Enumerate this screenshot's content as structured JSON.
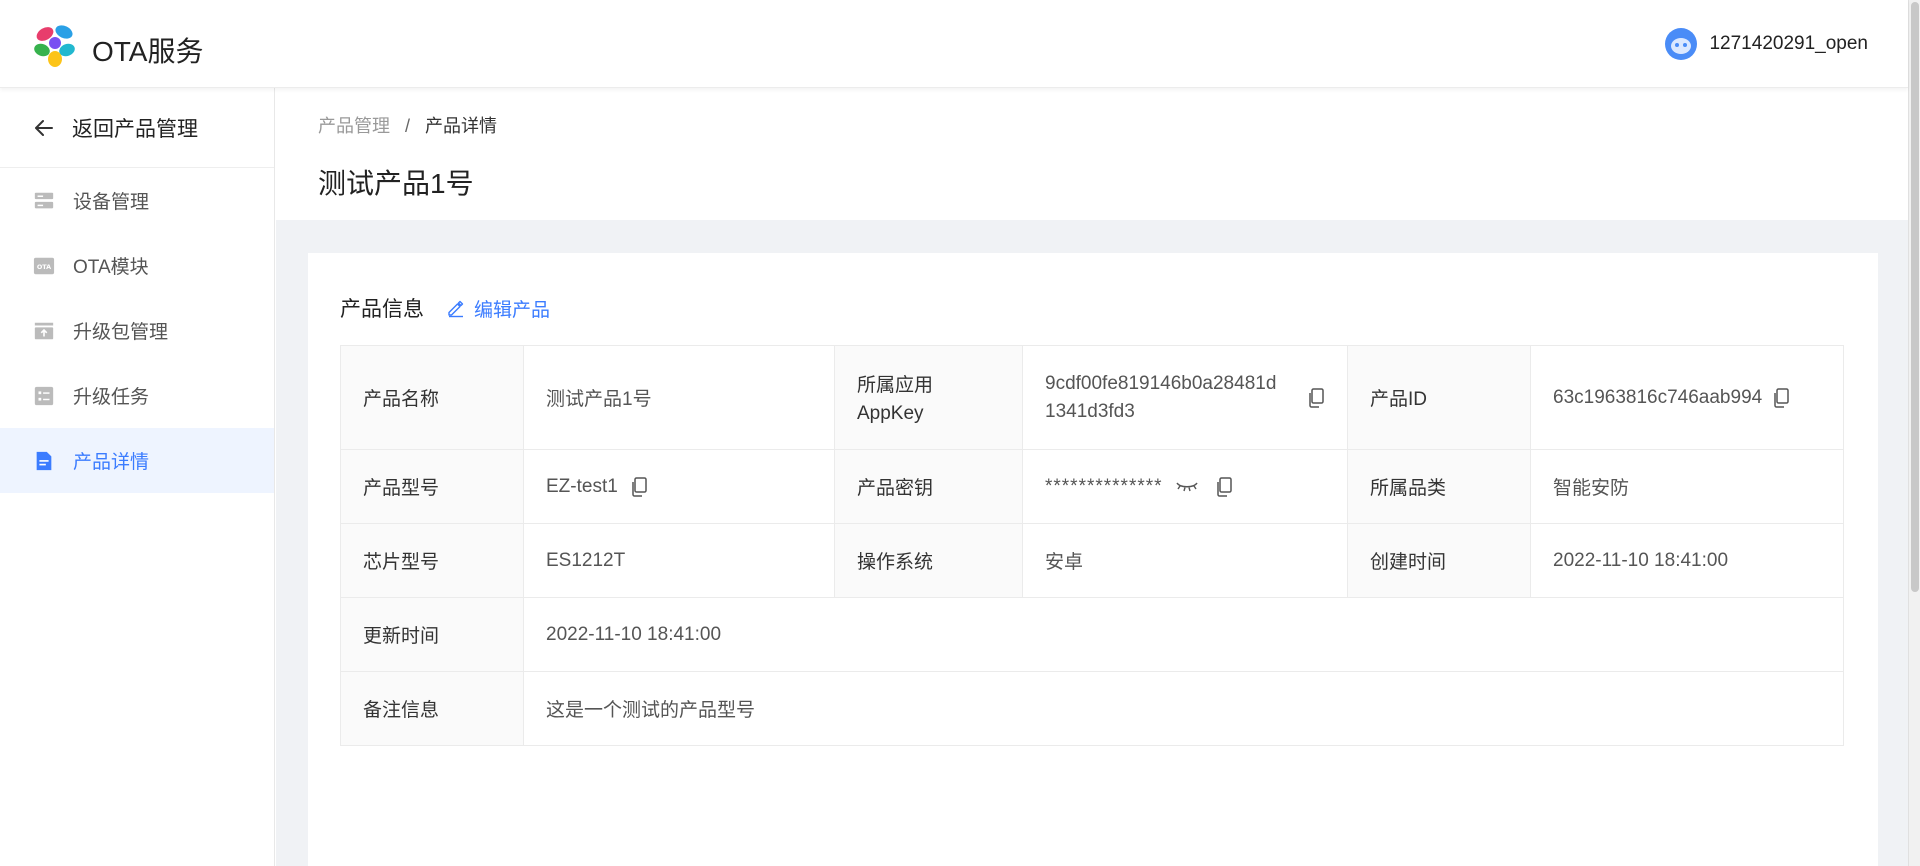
{
  "app": {
    "title": "OTA服务"
  },
  "user": {
    "name": "1271420291_open"
  },
  "sidebar": {
    "back_label": "返回产品管理",
    "items": [
      {
        "label": "设备管理",
        "icon": "server-icon",
        "active": false
      },
      {
        "label": "OTA模块",
        "icon": "ota-badge-icon",
        "active": false
      },
      {
        "label": "升级包管理",
        "icon": "upload-box-icon",
        "active": false
      },
      {
        "label": "升级任务",
        "icon": "task-list-icon",
        "active": false
      },
      {
        "label": "产品详情",
        "icon": "document-icon",
        "active": true
      }
    ]
  },
  "breadcrumb": {
    "parent": "产品管理",
    "separator": "/",
    "current": "产品详情"
  },
  "page_title": "测试产品1号",
  "section": {
    "title": "产品信息",
    "edit_label": "编辑产品"
  },
  "product": {
    "name_label": "产品名称",
    "name": "测试产品1号",
    "appkey_label_line1": "所属应用",
    "appkey_label_line2": "AppKey",
    "appkey_line1": "9cdf00fe819146b0a28481d",
    "appkey_line2": "1341d3fd3",
    "id_label": "产品ID",
    "id": "63c1963816c746aab994",
    "model_label": "产品型号",
    "model": "EZ-test1",
    "secret_label": "产品密钥",
    "secret": "**************",
    "category_label": "所属品类",
    "category": "智能安防",
    "chip_label": "芯片型号",
    "chip": "ES1212T",
    "os_label": "操作系统",
    "os": "安卓",
    "created_label": "创建时间",
    "created": "2022-11-10 18:41:00",
    "updated_label": "更新时间",
    "updated": "2022-11-10 18:41:00",
    "remark_label": "备注信息",
    "remark": "这是一个测试的产品型号"
  },
  "colors": {
    "accent": "#3b7cff",
    "active_bg": "#eef4ff",
    "page_bg": "#f0f2f5"
  }
}
